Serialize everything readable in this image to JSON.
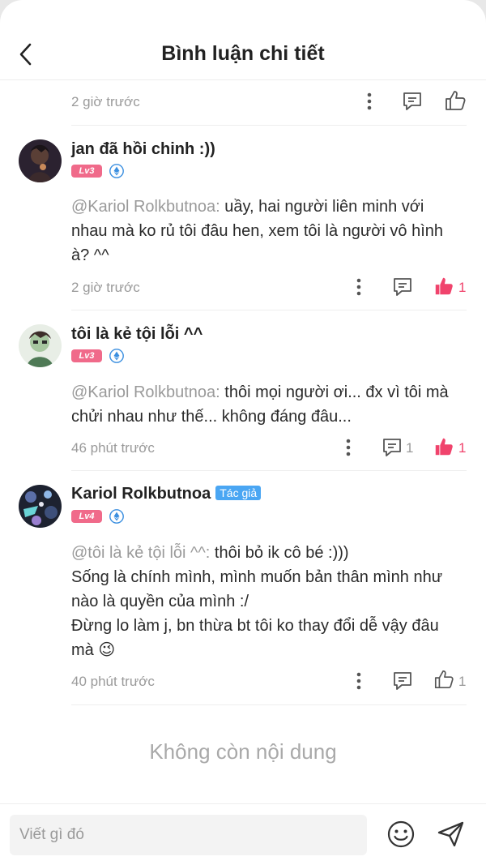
{
  "header": {
    "title": "Bình luận chi tiết"
  },
  "top_meta": {
    "time": "2 giờ trước"
  },
  "comments": [
    {
      "username": "jan đã hồi chinh :))",
      "level": "Lv3",
      "mention": "@Kariol Rolkbutnoa:",
      "text_lines": [
        "uầy, hai người liên minh với",
        "nhau mà ko rủ tôi đâu hen, xem tôi là người vô hình",
        "à? ^^"
      ],
      "time": "2 giờ trước",
      "reply_count": "",
      "like_count": "1"
    },
    {
      "username": "tôi là kẻ tội lỗi ^^",
      "level": "Lv3",
      "mention": "@Kariol Rolkbutnoa:",
      "text_lines": [
        "thôi mọi người ơi... đx vì tôi mà",
        "chửi nhau như thế... không đáng đâu..."
      ],
      "time": "46 phút trước",
      "reply_count": "1",
      "like_count": "1"
    },
    {
      "username": "Kariol Rolkbutnoa",
      "author_tag": "Tác giả",
      "level": "Lv4",
      "mention": "@tôi là kẻ tội lỗi ^^:",
      "text_lines": [
        "thôi bỏ ik cô bé :)))",
        "Sống là chính mình, mình muốn bản thân mình như",
        "nào là quyền của mình :/",
        "Đừng lo làm j, bn thừa bt tôi ko thay đổi dễ vậy đâu",
        "mà 😉"
      ],
      "time": "40 phút trước",
      "reply_count": "",
      "like_count": "1"
    }
  ],
  "end_message": "Không còn nội dung",
  "footer": {
    "input_placeholder": "Viết gì đó"
  },
  "colors": {
    "like_active": "#f0436c",
    "level_badge": "#f06a8a",
    "author_tag": "#4aa6f3"
  }
}
